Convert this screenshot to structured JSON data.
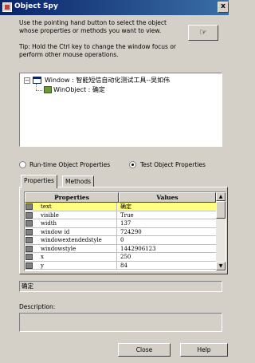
{
  "window": {
    "title": "Object Spy",
    "close_glyph": "x"
  },
  "instructions": {
    "intro": "Use the pointing hand button to select the object whose properties or methods you want to view.",
    "tip": "Tip: Hold the Ctrl key to change the window focus or perform other mouse operations.",
    "hand_icon": "☞"
  },
  "tree": {
    "expander": "−",
    "root_label": "Window : 智能短信自动化测试工具--吴如伟",
    "child_label": "WinObject : 确定"
  },
  "view_mode": {
    "runtime_label": "Run-time Object Properties",
    "test_label": "Test Object Properties",
    "selected": "test"
  },
  "tabs": [
    {
      "label": "Properties",
      "active": true
    },
    {
      "label": "Methods",
      "active": false
    }
  ],
  "grid": {
    "headers": {
      "name": "Properties",
      "value": "Values"
    },
    "rows": [
      {
        "name": "text",
        "value": "确定",
        "selected": true
      },
      {
        "name": "visible",
        "value": "True"
      },
      {
        "name": "width",
        "value": "137"
      },
      {
        "name": "window id",
        "value": "724290"
      },
      {
        "name": "windowextendedstyle",
        "value": "0"
      },
      {
        "name": "windowstyle",
        "value": "1442906123"
      },
      {
        "name": "x",
        "value": "250"
      },
      {
        "name": "y",
        "value": "84"
      }
    ],
    "scroll_up": "▲",
    "scroll_down": "▼"
  },
  "selected_value": "确定",
  "description": {
    "label": "Description:",
    "text": ""
  },
  "buttons": {
    "close": "Close",
    "help": "Help"
  }
}
